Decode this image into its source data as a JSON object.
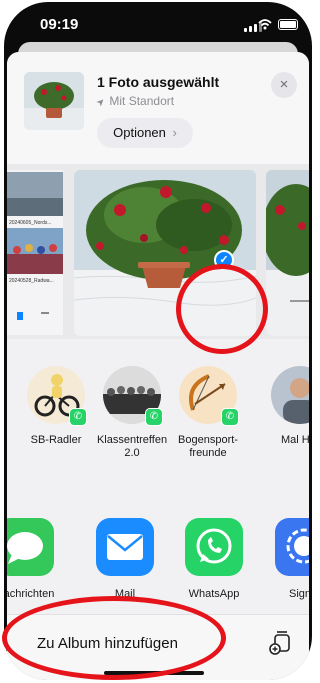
{
  "status_bar": {
    "time": "09:19"
  },
  "header": {
    "title": "1 Foto ausgewählt",
    "location_label": "Mit Standort",
    "options_label": "Optionen",
    "options_chevron": "›",
    "close_icon": "×"
  },
  "photo_strip": {
    "left_labels": [
      "20240605_Nords...",
      "20240528_Radwa..."
    ],
    "selected_check": "✓"
  },
  "people": [
    {
      "name": "SB-Radler"
    },
    {
      "name": "Klassentreffen 2.0"
    },
    {
      "name": "Bogensport-freunde"
    },
    {
      "name": "Mal He"
    }
  ],
  "apps": [
    {
      "name": "Nachrichten",
      "color": "#34c759"
    },
    {
      "name": "Mail",
      "color": "#1a8cff"
    },
    {
      "name": "WhatsApp",
      "color": "#25d366"
    },
    {
      "name": "Signal",
      "color": "#3a76f0"
    }
  ],
  "action": {
    "label": "Zu Album hinzufügen"
  },
  "colors": {
    "annotation_red": "#e5131a",
    "accent_blue": "#0a84ff"
  }
}
